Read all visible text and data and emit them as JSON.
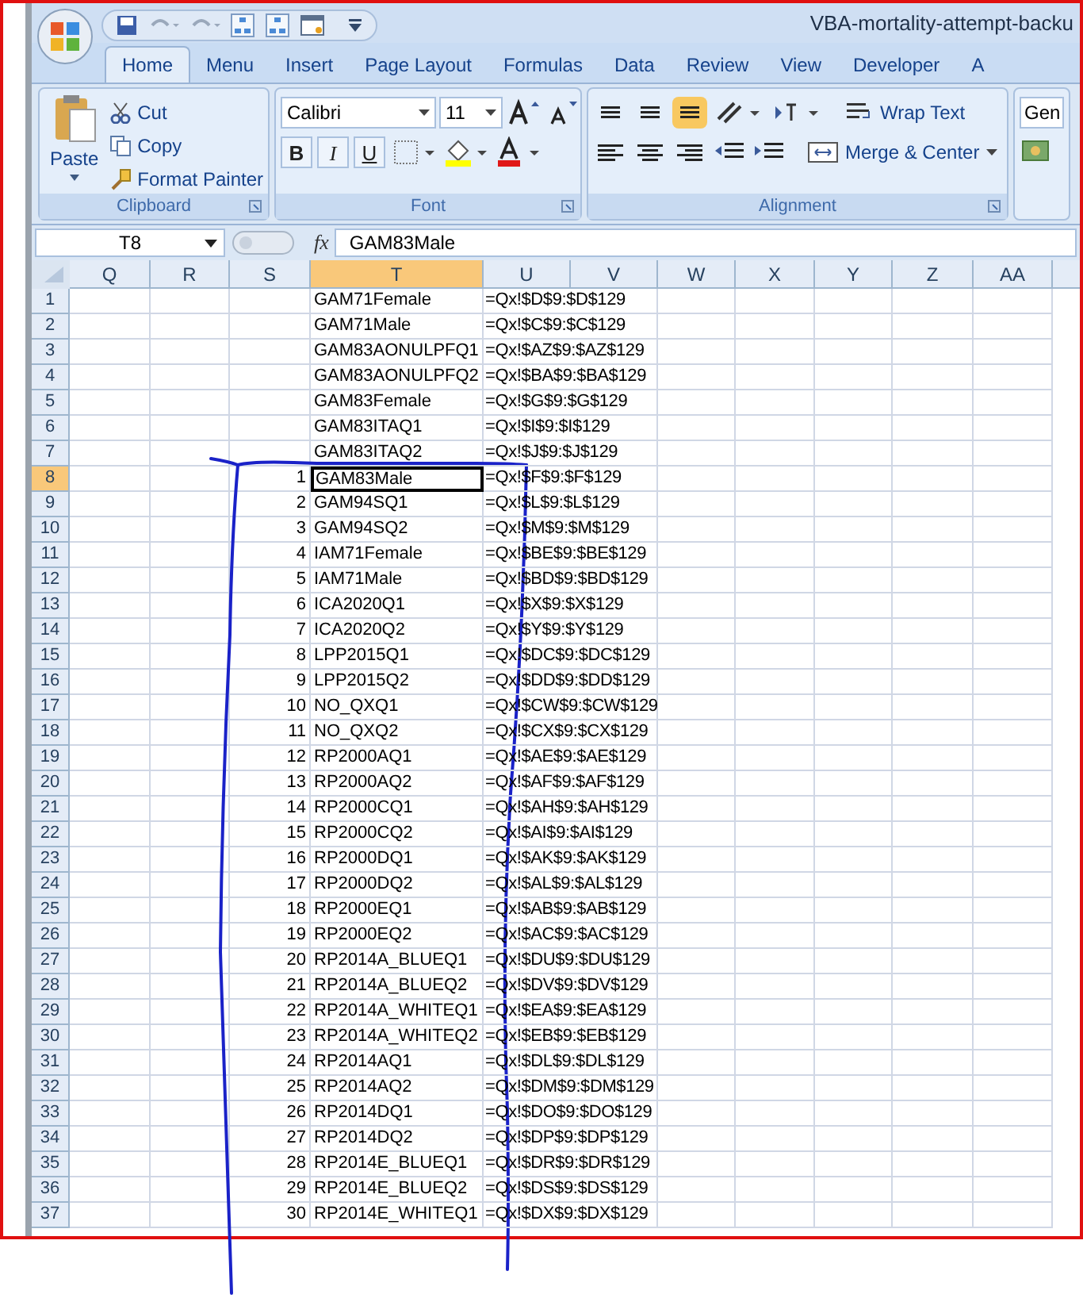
{
  "window": {
    "title": "VBA-mortality-attempt-backu"
  },
  "tabs": [
    {
      "label": "Home",
      "selected": true
    },
    {
      "label": "Menu",
      "selected": false
    },
    {
      "label": "Insert",
      "selected": false
    },
    {
      "label": "Page Layout",
      "selected": false
    },
    {
      "label": "Formulas",
      "selected": false
    },
    {
      "label": "Data",
      "selected": false
    },
    {
      "label": "Review",
      "selected": false
    },
    {
      "label": "View",
      "selected": false
    },
    {
      "label": "Developer",
      "selected": false
    },
    {
      "label": "A",
      "selected": false
    }
  ],
  "ribbon": {
    "clipboard": {
      "label": "Clipboard",
      "paste": "Paste",
      "cut": "Cut",
      "copy": "Copy",
      "format_painter": "Format Painter"
    },
    "font": {
      "label": "Font",
      "font_name": "Calibri",
      "font_size": "11",
      "bold": "B",
      "italic": "I",
      "underline": "U"
    },
    "alignment": {
      "label": "Alignment",
      "wrap_text": "Wrap Text",
      "merge_center": "Merge & Center"
    },
    "number": {
      "format": "Gen"
    }
  },
  "formula_bar": {
    "name_box": "T8",
    "function_symbol": "fx",
    "value": "GAM83Male"
  },
  "columns": [
    {
      "label": "Q",
      "selected": false
    },
    {
      "label": "R",
      "selected": false
    },
    {
      "label": "S",
      "selected": false
    },
    {
      "label": "T",
      "selected": true
    },
    {
      "label": "U",
      "selected": false
    },
    {
      "label": "V",
      "selected": false
    },
    {
      "label": "W",
      "selected": false
    },
    {
      "label": "X",
      "selected": false
    },
    {
      "label": "Y",
      "selected": false
    },
    {
      "label": "Z",
      "selected": false
    },
    {
      "label": "AA",
      "selected": false
    }
  ],
  "rows": [
    {
      "header": "1",
      "selected": false,
      "active": false,
      "column_t": "GAM71Female",
      "column_u": "=Qx!$D$9:$D$129"
    },
    {
      "header": "2",
      "selected": false,
      "active": false,
      "column_t": "GAM71Male",
      "column_u": "=Qx!$C$9:$C$129"
    },
    {
      "header": "3",
      "selected": false,
      "active": false,
      "column_t": "GAM83AONULPFQ1",
      "column_u": "=Qx!$AZ$9:$AZ$129"
    },
    {
      "header": "4",
      "selected": false,
      "active": false,
      "column_t": "GAM83AONULPFQ2",
      "column_u": "=Qx!$BA$9:$BA$129"
    },
    {
      "header": "5",
      "selected": false,
      "active": false,
      "column_t": "GAM83Female",
      "column_u": "=Qx!$G$9:$G$129"
    },
    {
      "header": "6",
      "selected": false,
      "active": false,
      "column_t": "GAM83ITAQ1",
      "column_u": "=Qx!$I$9:$I$129"
    },
    {
      "header": "7",
      "selected": false,
      "active": false,
      "column_t": "GAM83ITAQ2",
      "column_u": "=Qx!$J$9:$J$129"
    },
    {
      "header": "8",
      "selected": true,
      "active": true,
      "column_s": "1",
      "column_t": "GAM83Male",
      "column_u": "=Qx!$F$9:$F$129"
    },
    {
      "header": "9",
      "selected": false,
      "active": false,
      "column_s": "2",
      "column_t": "GAM94SQ1",
      "column_u": "=Qx!$L$9:$L$129"
    },
    {
      "header": "10",
      "selected": false,
      "active": false,
      "column_s": "3",
      "column_t": "GAM94SQ2",
      "column_u": "=Qx!$M$9:$M$129"
    },
    {
      "header": "11",
      "selected": false,
      "active": false,
      "column_s": "4",
      "column_t": "IAM71Female",
      "column_u": "=Qx!$BE$9:$BE$129"
    },
    {
      "header": "12",
      "selected": false,
      "active": false,
      "column_s": "5",
      "column_t": "IAM71Male",
      "column_u": "=Qx!$BD$9:$BD$129"
    },
    {
      "header": "13",
      "selected": false,
      "active": false,
      "column_s": "6",
      "column_t": "ICA2020Q1",
      "column_u": "=Qx!$X$9:$X$129"
    },
    {
      "header": "14",
      "selected": false,
      "active": false,
      "column_s": "7",
      "column_t": "ICA2020Q2",
      "column_u": "=Qx!$Y$9:$Y$129"
    },
    {
      "header": "15",
      "selected": false,
      "active": false,
      "column_s": "8",
      "column_t": "LPP2015Q1",
      "column_u": "=Qx!$DC$9:$DC$129"
    },
    {
      "header": "16",
      "selected": false,
      "active": false,
      "column_s": "9",
      "column_t": "LPP2015Q2",
      "column_u": "=Qx!$DD$9:$DD$129"
    },
    {
      "header": "17",
      "selected": false,
      "active": false,
      "column_s": "10",
      "column_t": "NO_QXQ1",
      "column_u": "=Qx!$CW$9:$CW$129"
    },
    {
      "header": "18",
      "selected": false,
      "active": false,
      "column_s": "11",
      "column_t": "NO_QXQ2",
      "column_u": "=Qx!$CX$9:$CX$129"
    },
    {
      "header": "19",
      "selected": false,
      "active": false,
      "column_s": "12",
      "column_t": "RP2000AQ1",
      "column_u": "=Qx!$AE$9:$AE$129"
    },
    {
      "header": "20",
      "selected": false,
      "active": false,
      "column_s": "13",
      "column_t": "RP2000AQ2",
      "column_u": "=Qx!$AF$9:$AF$129"
    },
    {
      "header": "21",
      "selected": false,
      "active": false,
      "column_s": "14",
      "column_t": "RP2000CQ1",
      "column_u": "=Qx!$AH$9:$AH$129"
    },
    {
      "header": "22",
      "selected": false,
      "active": false,
      "column_s": "15",
      "column_t": "RP2000CQ2",
      "column_u": "=Qx!$AI$9:$AI$129"
    },
    {
      "header": "23",
      "selected": false,
      "active": false,
      "column_s": "16",
      "column_t": "RP2000DQ1",
      "column_u": "=Qx!$AK$9:$AK$129"
    },
    {
      "header": "24",
      "selected": false,
      "active": false,
      "column_s": "17",
      "column_t": "RP2000DQ2",
      "column_u": "=Qx!$AL$9:$AL$129"
    },
    {
      "header": "25",
      "selected": false,
      "active": false,
      "column_s": "18",
      "column_t": "RP2000EQ1",
      "column_u": "=Qx!$AB$9:$AB$129"
    },
    {
      "header": "26",
      "selected": false,
      "active": false,
      "column_s": "19",
      "column_t": "RP2000EQ2",
      "column_u": "=Qx!$AC$9:$AC$129"
    },
    {
      "header": "27",
      "selected": false,
      "active": false,
      "column_s": "20",
      "column_t": "RP2014A_BLUEQ1",
      "column_u": "=Qx!$DU$9:$DU$129"
    },
    {
      "header": "28",
      "selected": false,
      "active": false,
      "column_s": "21",
      "column_t": "RP2014A_BLUEQ2",
      "column_u": "=Qx!$DV$9:$DV$129"
    },
    {
      "header": "29",
      "selected": false,
      "active": false,
      "column_s": "22",
      "column_t": "RP2014A_WHITEQ1",
      "column_u": "=Qx!$EA$9:$EA$129"
    },
    {
      "header": "30",
      "selected": false,
      "active": false,
      "column_s": "23",
      "column_t": "RP2014A_WHITEQ2",
      "column_u": "=Qx!$EB$9:$EB$129"
    },
    {
      "header": "31",
      "selected": false,
      "active": false,
      "column_s": "24",
      "column_t": "RP2014AQ1",
      "column_u": "=Qx!$DL$9:$DL$129"
    },
    {
      "header": "32",
      "selected": false,
      "active": false,
      "column_s": "25",
      "column_t": "RP2014AQ2",
      "column_u": "=Qx!$DM$9:$DM$129"
    },
    {
      "header": "33",
      "selected": false,
      "active": false,
      "column_s": "26",
      "column_t": "RP2014DQ1",
      "column_u": "=Qx!$DO$9:$DO$129"
    },
    {
      "header": "34",
      "selected": false,
      "active": false,
      "column_s": "27",
      "column_t": "RP2014DQ2",
      "column_u": "=Qx!$DP$9:$DP$129"
    },
    {
      "header": "35",
      "selected": false,
      "active": false,
      "column_s": "28",
      "column_t": "RP2014E_BLUEQ1",
      "column_u": "=Qx!$DR$9:$DR$129"
    },
    {
      "header": "36",
      "selected": false,
      "active": false,
      "column_s": "29",
      "column_t": "RP2014E_BLUEQ2",
      "column_u": "=Qx!$DS$9:$DS$129"
    },
    {
      "header": "37",
      "selected": false,
      "active": false,
      "column_s": "30",
      "column_t": "RP2014E_WHITEQ1",
      "column_u": "=Qx!$DX$9:$DX$129"
    }
  ]
}
